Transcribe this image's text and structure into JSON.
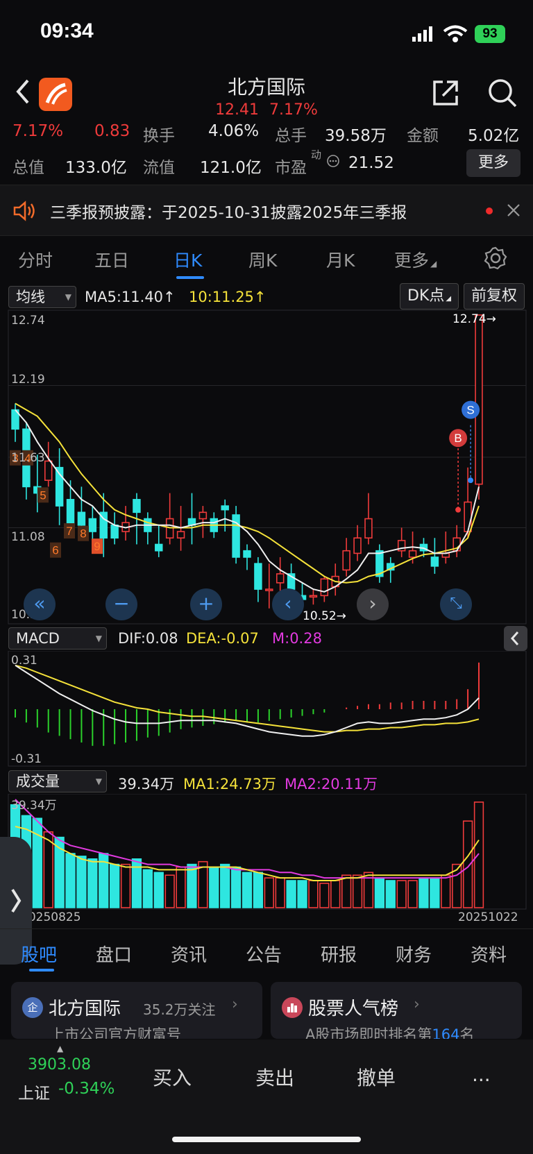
{
  "status_bar": {
    "time": "09:34",
    "battery": "93"
  },
  "nav": {
    "title": "北方国际",
    "price": "12.41",
    "change_pct": "7.17%"
  },
  "quote": {
    "row1": {
      "pct": "7.17%",
      "change": "0.83",
      "turnover_label": "换手",
      "turnover": "4.06%",
      "volume_label": "总手",
      "volume": "39.58万",
      "amount_label": "金额",
      "amount": "5.02亿"
    },
    "row2": {
      "mktcap_label": "总值",
      "mktcap": "133.0亿",
      "float_label": "流值",
      "float": "121.0亿",
      "pe_label": "市盈",
      "pe_sup": "动",
      "pe": "21.52",
      "more": "更多"
    }
  },
  "banner": {
    "text": "三季报预披露：于2025-10-31披露2025年三季报"
  },
  "tabs": [
    "分时",
    "五日",
    "日K",
    "周K",
    "月K",
    "更多"
  ],
  "active_tab": "日K",
  "ma_bar": {
    "selector": "均线",
    "ma5": "MA5:11.40↑",
    "ma10": "10:11.25↑",
    "dk": "DK点",
    "adjust": "前复权"
  },
  "price_axis": [
    "12.74",
    "12.19",
    "11.63",
    "11.08",
    "10.52"
  ],
  "price_marks": {
    "high": "12.74→",
    "low": "10.52→"
  },
  "candles": [
    [
      12.0,
      11.85,
      12.05,
      11.75
    ],
    [
      11.85,
      11.4,
      11.9,
      11.3
    ],
    [
      11.4,
      11.35,
      11.65,
      11.2
    ],
    [
      11.45,
      11.6,
      11.75,
      11.4
    ],
    [
      11.55,
      11.25,
      11.7,
      11.1
    ],
    [
      11.3,
      11.05,
      11.45,
      11.0
    ],
    [
      11.2,
      11.1,
      11.4,
      11.0
    ],
    [
      11.15,
      11.05,
      11.25,
      10.95
    ],
    [
      11.2,
      11.0,
      11.35,
      10.85
    ],
    [
      11.1,
      11.0,
      11.2,
      10.95
    ],
    [
      11.05,
      11.12,
      11.25,
      10.98
    ],
    [
      11.3,
      11.2,
      11.35,
      10.95
    ],
    [
      11.15,
      11.05,
      11.2,
      10.95
    ],
    [
      10.95,
      10.9,
      11.1,
      10.85
    ],
    [
      11.0,
      11.15,
      11.35,
      10.95
    ],
    [
      11.0,
      11.05,
      11.25,
      10.9
    ],
    [
      11.15,
      11.1,
      11.35,
      10.95
    ],
    [
      11.15,
      11.2,
      11.25,
      11.0
    ],
    [
      11.15,
      11.05,
      11.2,
      11.0
    ],
    [
      11.25,
      11.22,
      11.3,
      11.05
    ],
    [
      11.18,
      10.85,
      11.25,
      10.8
    ],
    [
      10.9,
      10.85,
      10.95,
      10.75
    ],
    [
      10.8,
      10.6,
      10.85,
      10.5
    ],
    [
      10.6,
      10.6,
      10.8,
      10.45
    ],
    [
      10.65,
      10.72,
      10.85,
      10.55
    ],
    [
      10.72,
      10.6,
      10.8,
      10.55
    ],
    [
      10.55,
      10.52,
      10.65,
      10.5
    ],
    [
      10.55,
      10.55,
      10.6,
      10.48
    ],
    [
      10.55,
      10.68,
      10.7,
      10.5
    ],
    [
      10.62,
      10.7,
      10.8,
      10.55
    ],
    [
      10.75,
      10.9,
      11.0,
      10.7
    ],
    [
      10.88,
      11.0,
      11.1,
      10.82
    ],
    [
      11.0,
      11.15,
      11.35,
      10.95
    ],
    [
      10.9,
      10.7,
      10.95,
      10.65
    ],
    [
      10.8,
      10.75,
      10.85,
      10.65
    ],
    [
      10.9,
      10.98,
      11.08,
      10.85
    ],
    [
      10.85,
      10.9,
      11.05,
      10.8
    ],
    [
      10.95,
      10.9,
      11.0,
      10.85
    ],
    [
      10.85,
      10.78,
      11.0,
      10.72
    ],
    [
      10.85,
      10.88,
      11.05,
      10.8
    ],
    [
      10.9,
      11.0,
      11.1,
      10.85
    ],
    [
      11.05,
      11.28,
      11.55,
      11.0
    ],
    [
      11.42,
      12.74,
      12.74,
      11.3
    ]
  ],
  "ma5_series": [
    12.0,
    11.9,
    11.75,
    11.62,
    11.5,
    11.4,
    11.3,
    11.25,
    11.15,
    11.1,
    11.08,
    11.1,
    11.1,
    11.1,
    11.1,
    11.08,
    11.1,
    11.12,
    11.12,
    11.15,
    11.12,
    11.05,
    10.95,
    10.82,
    10.75,
    10.7,
    10.65,
    10.6,
    10.58,
    10.62,
    10.68,
    10.75,
    10.88,
    10.88,
    10.9,
    10.92,
    10.93,
    10.92,
    10.88,
    10.88,
    10.9,
    11.05,
    11.4
  ],
  "ma10_series": [
    12.05,
    12.0,
    11.95,
    11.85,
    11.75,
    11.62,
    11.5,
    11.4,
    11.3,
    11.22,
    11.18,
    11.15,
    11.12,
    11.1,
    11.08,
    11.08,
    11.08,
    11.1,
    11.1,
    11.1,
    11.1,
    11.08,
    11.05,
    11.0,
    10.94,
    10.88,
    10.82,
    10.76,
    10.7,
    10.66,
    10.65,
    10.66,
    10.7,
    10.72,
    10.76,
    10.8,
    10.84,
    10.87,
    10.88,
    10.9,
    10.92,
    11.0,
    11.25
  ],
  "markers": {
    "buy": "B",
    "sell": "S"
  },
  "macd_bar": {
    "selector": "MACD",
    "dif": "DIF:0.08",
    "dea": "DEA:-0.07",
    "m": "M:0.28"
  },
  "macd_axis": [
    "0.31",
    "-0.31"
  ],
  "macd_hist": [
    -0.05,
    -0.08,
    -0.11,
    -0.14,
    -0.16,
    -0.18,
    -0.2,
    -0.22,
    -0.22,
    -0.21,
    -0.2,
    -0.19,
    -0.17,
    -0.16,
    -0.14,
    -0.12,
    -0.11,
    -0.1,
    -0.09,
    -0.08,
    -0.07,
    -0.08,
    -0.08,
    -0.07,
    -0.06,
    -0.05,
    -0.04,
    -0.03,
    -0.02,
    0.0,
    0.01,
    0.02,
    0.03,
    0.03,
    0.04,
    0.04,
    0.05,
    0.05,
    0.05,
    0.05,
    0.06,
    0.12,
    0.28
  ],
  "macd_dif": [
    0.31,
    0.26,
    0.21,
    0.16,
    0.11,
    0.07,
    0.03,
    -0.01,
    -0.04,
    -0.07,
    -0.09,
    -0.1,
    -0.1,
    -0.1,
    -0.09,
    -0.08,
    -0.08,
    -0.08,
    -0.08,
    -0.09,
    -0.1,
    -0.12,
    -0.14,
    -0.16,
    -0.17,
    -0.18,
    -0.19,
    -0.19,
    -0.18,
    -0.16,
    -0.13,
    -0.1,
    -0.09,
    -0.1,
    -0.1,
    -0.09,
    -0.08,
    -0.07,
    -0.07,
    -0.06,
    -0.04,
    0.0,
    0.08
  ],
  "macd_dea": [
    0.31,
    0.29,
    0.26,
    0.23,
    0.2,
    0.17,
    0.14,
    0.11,
    0.08,
    0.05,
    0.03,
    0.01,
    0.0,
    -0.02,
    -0.03,
    -0.04,
    -0.05,
    -0.05,
    -0.06,
    -0.07,
    -0.08,
    -0.09,
    -0.1,
    -0.11,
    -0.12,
    -0.13,
    -0.14,
    -0.15,
    -0.16,
    -0.16,
    -0.15,
    -0.15,
    -0.14,
    -0.14,
    -0.13,
    -0.13,
    -0.12,
    -0.11,
    -0.11,
    -0.1,
    -0.1,
    -0.09,
    -0.07
  ],
  "vol_bar": {
    "selector": "成交量",
    "vol": "39.34万",
    "ma1": "MA1:24.73万",
    "ma2": "MA2:20.11万"
  },
  "vol_axis": "39.34万",
  "volumes": [
    38,
    34,
    33,
    28,
    26,
    20,
    19,
    18,
    20,
    16,
    16,
    18,
    14,
    13,
    12,
    15,
    16,
    17,
    15,
    16,
    15,
    13,
    13,
    11,
    11,
    10,
    10,
    10,
    9,
    10,
    12,
    12,
    13,
    11,
    10,
    10,
    10,
    11,
    11,
    12,
    16,
    32,
    39
  ],
  "vol_ma1": [
    30,
    29,
    27,
    25,
    22,
    20,
    18,
    17,
    17,
    16,
    15,
    15,
    15,
    14,
    14,
    14,
    14,
    15,
    15,
    15,
    15,
    14,
    13,
    12,
    11,
    11,
    11,
    10,
    10,
    10,
    11,
    11,
    12,
    12,
    12,
    12,
    12,
    12,
    12,
    12,
    14,
    19,
    25
  ],
  "vol_ma2": [
    40,
    36,
    32,
    28,
    25,
    23,
    22,
    21,
    20,
    19,
    18,
    17,
    16,
    16,
    16,
    15,
    15,
    15,
    15,
    15,
    14,
    14,
    14,
    14,
    13,
    13,
    12,
    12,
    11,
    11,
    11,
    11,
    11,
    11,
    11,
    11,
    11,
    11,
    11,
    11,
    12,
    15,
    20
  ],
  "dates": {
    "start": "20250825",
    "end": "20251022"
  },
  "bottom_tabs": [
    "股吧",
    "盘口",
    "资讯",
    "公告",
    "研报",
    "财务",
    "资料"
  ],
  "cards": [
    {
      "title": "北方国际",
      "sub": "35.2万关注",
      "desc": "上市公司官方财富号"
    },
    {
      "title": "股票人气榜",
      "desc_pre": "A股市场即时排名第",
      "rank": "164",
      "desc_post": "名"
    }
  ],
  "footer": {
    "index": "3903.08",
    "index_name": "上证",
    "index_pct": "-0.34%",
    "buy": "买入",
    "sell": "卖出",
    "cancel": "撤单",
    "more": "..."
  },
  "colors": {
    "up": "#ef3b3b",
    "down": "#2ee6e0",
    "accent": "#2f8bff"
  }
}
